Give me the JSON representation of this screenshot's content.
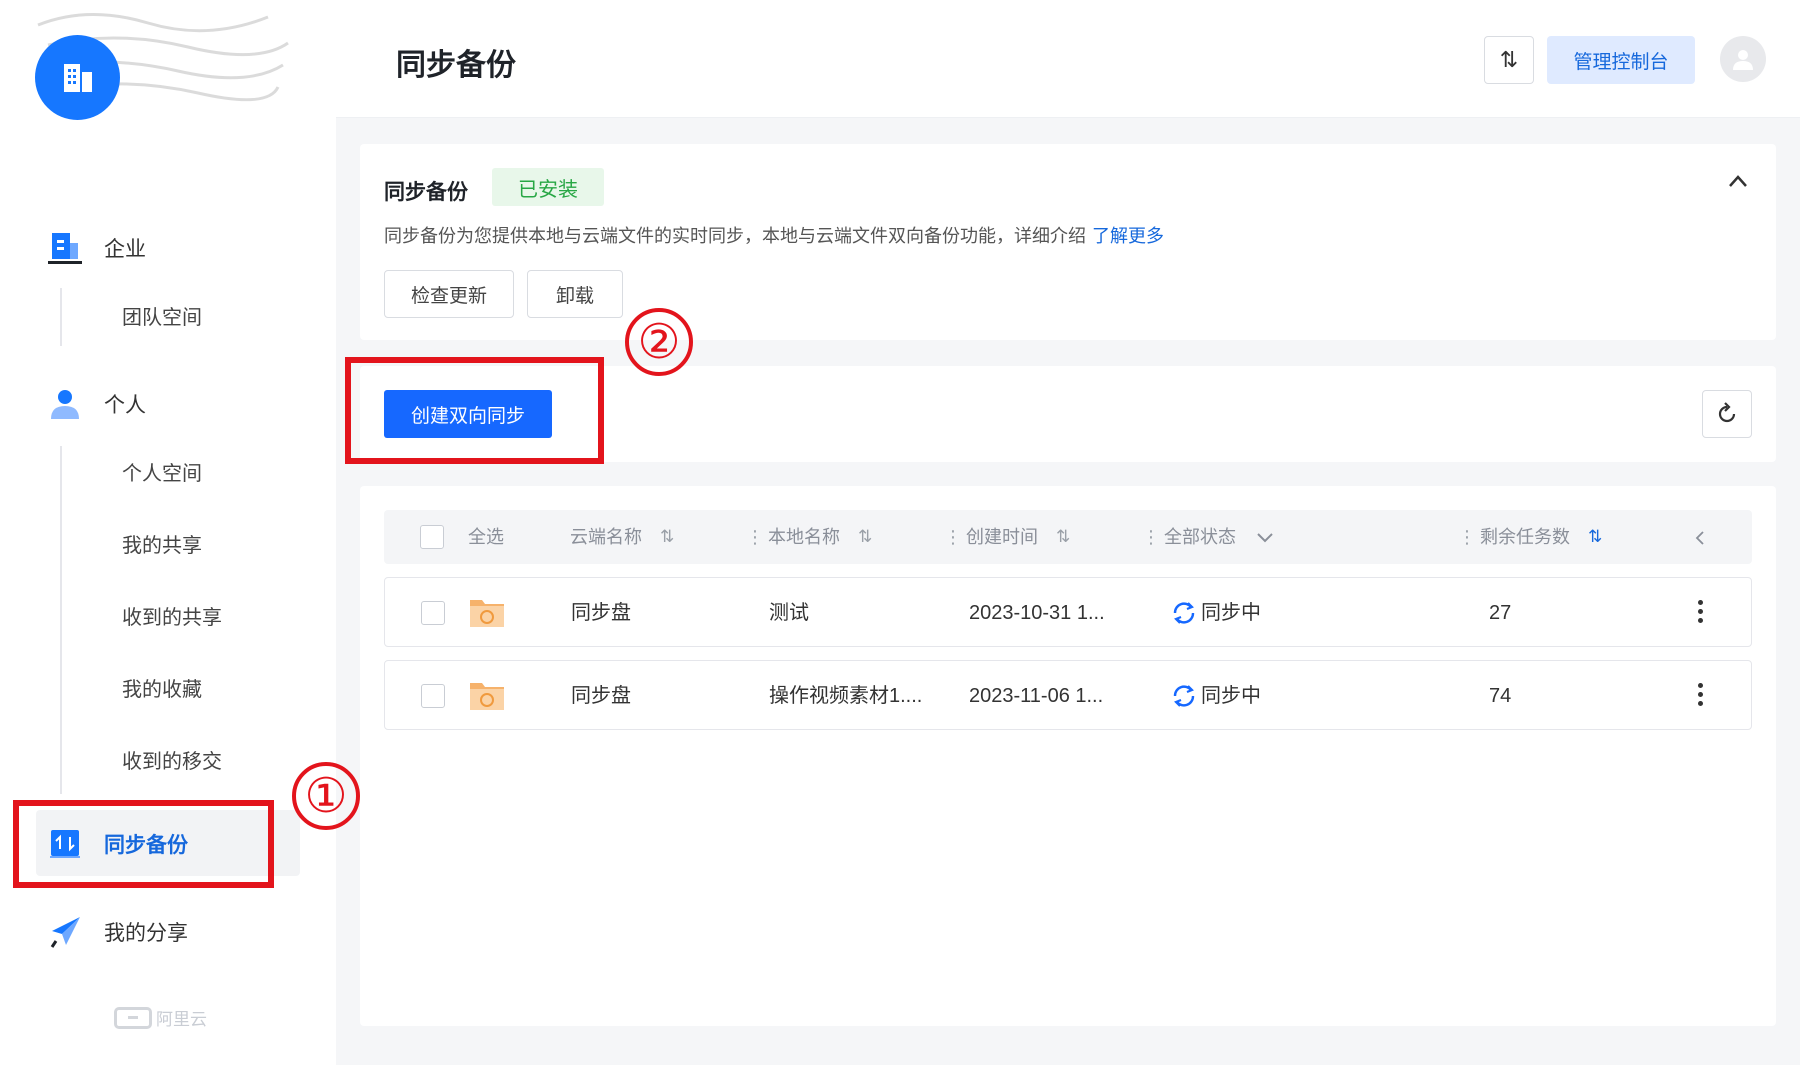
{
  "sidebar": {
    "enterprise_label": "企业",
    "team_space": "团队空间",
    "personal_label": "个人",
    "personal_items": [
      "个人空间",
      "我的共享",
      "收到的共享",
      "我的收藏",
      "收到的移交"
    ],
    "sync_backup": "同步备份",
    "my_share": "我的分享",
    "footer_brand": "阿里云"
  },
  "annotations": {
    "step1": "①",
    "step2": "②",
    "color": "#e3141c"
  },
  "header": {
    "title": "同步备份",
    "sort_icon": "⇅",
    "console_button": "管理控制台"
  },
  "info_card": {
    "title": "同步备份",
    "installed_badge": "已安装",
    "description": "同步备份为您提供本地与云端文件的实时同步，本地与云端文件双向备份功能，详细介绍",
    "learn_more": "了解更多",
    "check_update": "检查更新",
    "uninstall": "卸载"
  },
  "actions": {
    "create_button": "创建双向同步"
  },
  "table": {
    "select_all": "全选",
    "columns": [
      "云端名称",
      "本地名称",
      "创建时间",
      "全部状态",
      "剩余任务数"
    ],
    "rows": [
      {
        "cloud": "同步盘",
        "local": "测试",
        "created": "2023-10-31 1...",
        "status": "同步中",
        "tasks": "27"
      },
      {
        "cloud": "同步盘",
        "local": "操作视频素材1....",
        "created": "2023-11-06 1...",
        "status": "同步中",
        "tasks": "74"
      }
    ]
  },
  "colors": {
    "accent": "#1668ff",
    "installed_green": "#28a745"
  }
}
